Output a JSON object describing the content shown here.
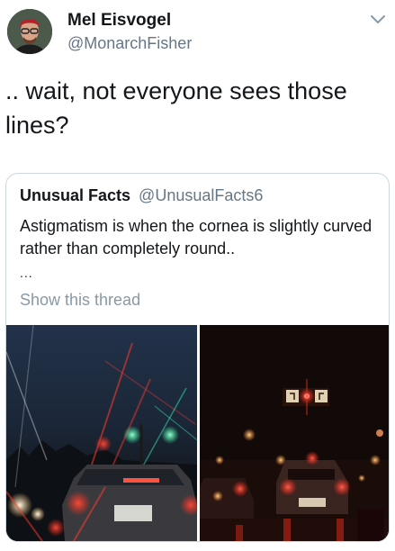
{
  "tweet": {
    "author": {
      "display_name": "Mel Eisvogel",
      "handle": "@MonarchFisher"
    },
    "text": ".. wait, not everyone sees those lines?",
    "menu_icon": "chevron-down-icon"
  },
  "quoted_tweet": {
    "display_name": "Unusual Facts",
    "handle": "@UnusualFacts6",
    "text": "Astigmatism is when the cornea is slightly curved rather than completely round..",
    "ellipsis": "...",
    "show_thread_label": "Show this thread",
    "link_color": "#8899a6"
  },
  "media": {
    "images": [
      "night-traffic-starburst-photo",
      "traffic-light-night-photo"
    ]
  },
  "colors": {
    "text": "#14171a",
    "secondary": "#657786",
    "border": "#ccd6dd"
  }
}
